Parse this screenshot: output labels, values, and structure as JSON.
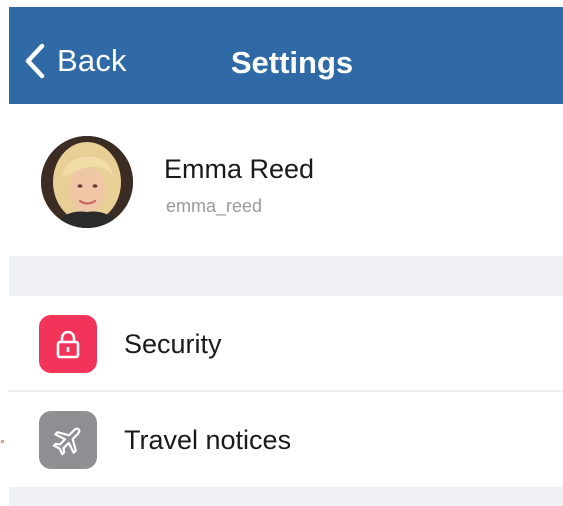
{
  "nav": {
    "back_label": "Back",
    "title": "Settings"
  },
  "profile": {
    "name": "Emma Reed",
    "username": "emma_reed"
  },
  "rows": [
    {
      "label": "Security",
      "icon": "lock-icon",
      "icon_color": "#f2335a"
    },
    {
      "label": "Travel notices",
      "icon": "airplane-icon",
      "icon_color": "#8e8e93"
    }
  ],
  "colors": {
    "nav_background": "#2f6aa6",
    "section_background": "#eff0f4"
  }
}
